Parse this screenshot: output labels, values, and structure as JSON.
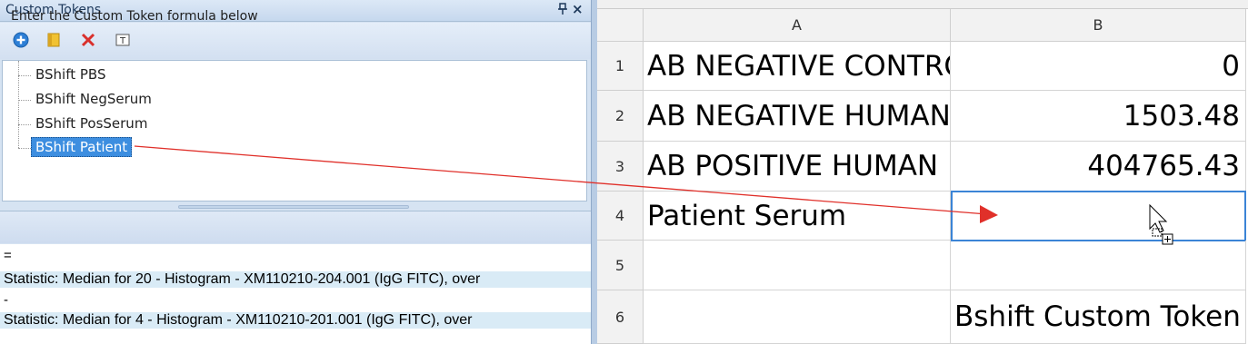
{
  "panel": {
    "title": "Custom Tokens",
    "pin_glyph": "₽",
    "close_glyph": "×",
    "toolbar": [
      "add-icon",
      "folder-icon",
      "delete-icon",
      "text-token-icon"
    ],
    "tree_items": [
      {
        "label": "BShift PBS",
        "selected": false
      },
      {
        "label": "BShift NegSerum",
        "selected": false
      },
      {
        "label": "BShift PosSerum",
        "selected": false
      },
      {
        "label": "BShift Patient",
        "selected": true
      }
    ],
    "formula_header": "Enter the Custom Token formula below",
    "formula_lines": [
      {
        "text": "=",
        "highlight": false
      },
      {
        "text": "Statistic: Median for 20 - Histogram - XM110210-204.001 (IgG FITC), over",
        "highlight": true
      },
      {
        "text": "-",
        "highlight": false
      },
      {
        "text": "Statistic: Median for 4  - Histogram - XM110210-201.001 (IgG FITC), over",
        "highlight": true
      }
    ]
  },
  "grid": {
    "columns": [
      "A",
      "B"
    ],
    "rows": [
      {
        "num": "1",
        "a": "AB NEGATIVE CONTROL",
        "b": "0"
      },
      {
        "num": "2",
        "a": "AB NEGATIVE HUMAN",
        "b": "1503.48"
      },
      {
        "num": "3",
        "a": "AB POSITIVE HUMAN",
        "b": "404765.43"
      },
      {
        "num": "4",
        "a": "Patient Serum",
        "b": ""
      },
      {
        "num": "5",
        "a": "",
        "b": ""
      },
      {
        "num": "6",
        "a": "",
        "b": "Bshift Custom Token"
      }
    ]
  },
  "colors": {
    "accent": "#3b84d6",
    "arrow": "#e0302a",
    "selected": "#3d8ee0"
  }
}
